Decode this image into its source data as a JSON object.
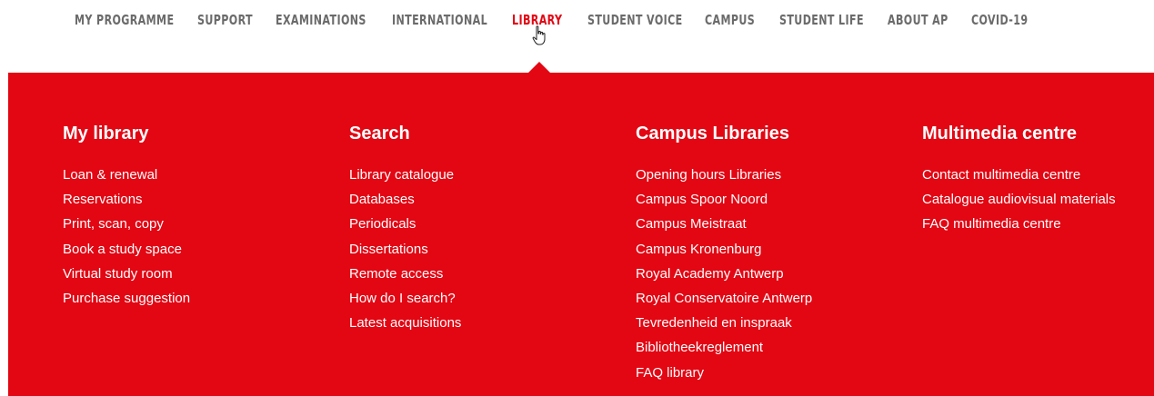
{
  "nav": {
    "items": [
      {
        "label": "MY PROGRAMME"
      },
      {
        "label": "SUPPORT"
      },
      {
        "label": "EXAMINATIONS"
      },
      {
        "label": "INTERNATIONAL"
      },
      {
        "label": "LIBRARY",
        "active": true
      },
      {
        "label": "STUDENT VOICE"
      },
      {
        "label": "CAMPUS"
      },
      {
        "label": "STUDENT LIFE"
      },
      {
        "label": "ABOUT AP"
      },
      {
        "label": "COVID-19"
      }
    ],
    "color": "#6b6b6b",
    "active_color": "#e30613"
  },
  "cursor": {
    "icon": "hand-pointer-icon"
  },
  "megamenu": {
    "background": "#e30613",
    "columns": [
      {
        "heading": "My library",
        "links": [
          "Loan & renewal",
          "Reservations",
          "Print, scan, copy",
          "Book a study space",
          "Virtual study room",
          "Purchase suggestion"
        ]
      },
      {
        "heading": "Search",
        "links": [
          "Library catalogue",
          "Databases",
          "Periodicals",
          "Dissertations",
          "Remote access",
          "How do I search?",
          "Latest acquisitions"
        ]
      },
      {
        "heading": "Campus Libraries",
        "links": [
          "Opening hours Libraries",
          "Campus Spoor Noord",
          "Campus Meistraat",
          "Campus Kronenburg",
          "Royal Academy Antwerp",
          "Royal Conservatoire Antwerp",
          "Tevredenheid en inspraak",
          "Bibliotheekreglement",
          "FAQ library"
        ]
      },
      {
        "heading": "Multimedia centre",
        "links": [
          "Contact multimedia centre",
          "Catalogue audiovisual materials",
          "FAQ multimedia centre"
        ]
      }
    ]
  }
}
